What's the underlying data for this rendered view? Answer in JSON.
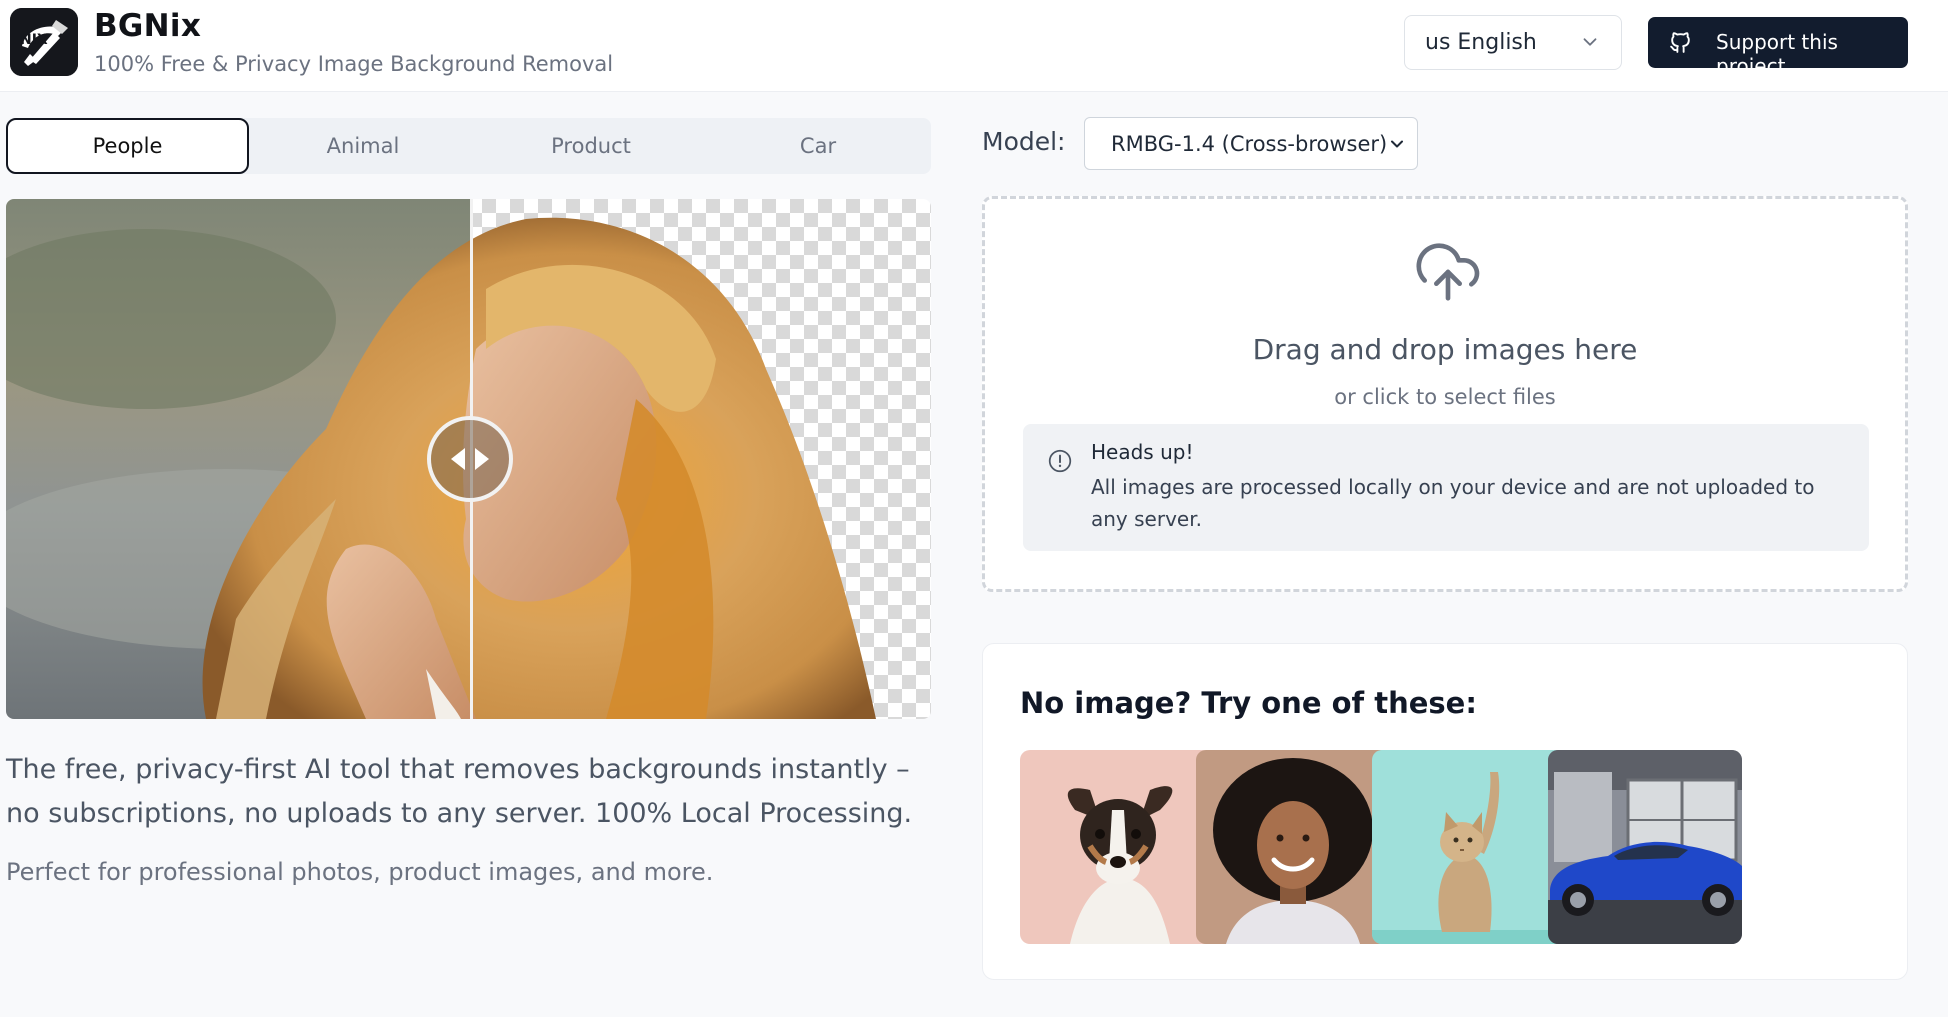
{
  "header": {
    "title": "BGNix",
    "subtitle": "100% Free & Privacy Image Background Removal",
    "logo_icon": "paint-brush-logo-icon",
    "language_label": "us English",
    "support_label": "Support this project",
    "support_icon": "github-icon"
  },
  "tabs": [
    {
      "label": "People",
      "active": true
    },
    {
      "label": "Animal",
      "active": false
    },
    {
      "label": "Product",
      "active": false
    },
    {
      "label": "Car",
      "active": false
    }
  ],
  "comparison": {
    "handle_icon": "compare-arrows-icon",
    "divider_fraction": 0.5
  },
  "description": {
    "lead": "The free, privacy-first AI tool that removes backgrounds instantly – no subscriptions, no uploads to any server. 100% Local Processing.",
    "sub": "Perfect for professional photos, product images, and more."
  },
  "model": {
    "label": "Model:",
    "selected": "RMBG-1.4 (Cross-browser)"
  },
  "dropzone": {
    "icon": "cloud-upload-icon",
    "title": "Drag and drop images here",
    "subtitle": "or click to select files",
    "alert_icon": "info-icon",
    "alert_title": "Heads up!",
    "alert_body": "All images are processed locally on your device and are not uploaded to any server."
  },
  "samples": {
    "title": "No image? Try one of these:",
    "items": [
      {
        "name": "dog"
      },
      {
        "name": "woman"
      },
      {
        "name": "cat"
      },
      {
        "name": "car"
      }
    ]
  },
  "colors": {
    "accent_dark": "#121c2e",
    "page_bg": "#f8f9fb"
  }
}
